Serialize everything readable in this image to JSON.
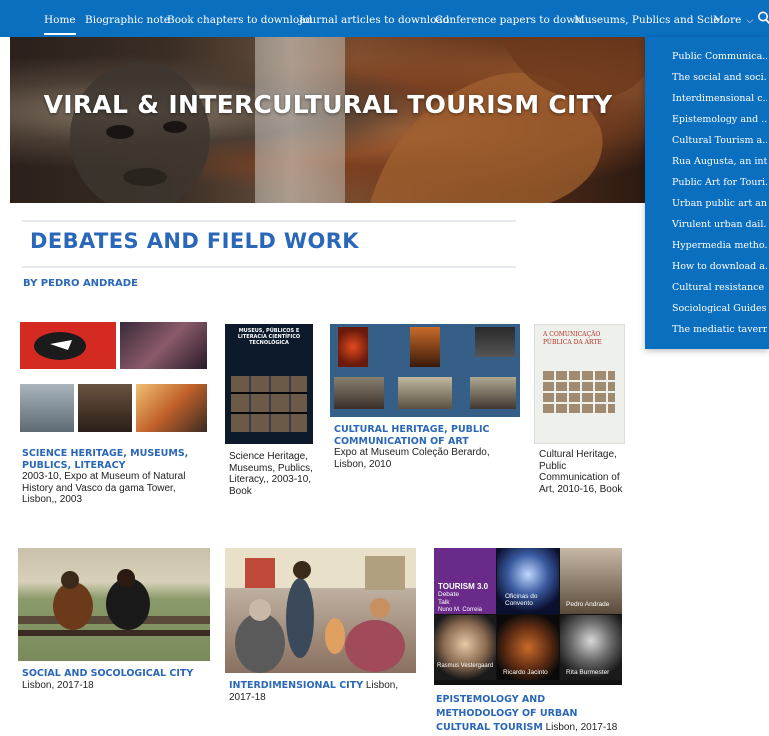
{
  "nav": {
    "items": [
      "Home",
      "Biographic note",
      "Book chapters to download",
      "Journal articles to download",
      "Conference papers to down...",
      "Museums, Publics and Scie..."
    ],
    "more_label": "More"
  },
  "dropdown": {
    "items": [
      "Public Communica...",
      "The social and soci...",
      "Interdimensional c...",
      "Epistemology and ...",
      "Cultural Tourism a...",
      "Rua Augusta, an int...",
      "Public Art for Touri...",
      "Urban public art an...",
      "Virulent urban dail...",
      "Hypermedia metho...",
      "How to download a...",
      "Cultural resistance ...",
      "Sociological Guides...",
      "The mediatic tavern"
    ]
  },
  "hero": {
    "title": "VIRAL & INTERCULTURAL TOURISM CITY"
  },
  "page": {
    "title": "DEBATES AND FIELD WORK",
    "byline": "BY PEDRO ANDRADE"
  },
  "cards": [
    {
      "link": "SCIENCE HERITAGE, MUSEUMS, PUBLICS, LITERACY",
      "desc": "2003-10, Expo at Museum of Natural History and Vasco da gama Tower, Lisbon,, 2003"
    },
    {
      "link": "",
      "desc": "Science Heritage, Museums, Publics, Literacy,, 2003-10, Book"
    },
    {
      "link": "CULTURAL HERITAGE, PUBLIC COMMUNICATION OF ART",
      "desc": "Expo at Museum Coleção Berardo, Lisbon, 2010"
    },
    {
      "link": "",
      "desc": "Cultural Heritage, Public Communication of Art, 2010-16, Book"
    },
    {
      "link": "SOCIAL AND SOCOLOGICAL CITY",
      "desc": "Lisbon,  2017-18"
    },
    {
      "link": "INTERDIMENSIONAL CITY",
      "desc": " Lisbon, 2017-18"
    },
    {
      "link": "EPISTEMOLOGY AND METHODOLOGY OF URBAN CULTURAL TOURISM",
      "desc": " Lisbon, 2017-18"
    }
  ],
  "book_cover": {
    "title": "MUSEUS, PÚBLICOS E LITERACIA CIENTÍFICO TECNOLÓGICA",
    "art_title": "A COMUNICAÇÃO PÚBLICA DA ARTE"
  },
  "poster": {
    "header": "TOURISM 3.0",
    "sub1": "Debate",
    "sub2": "Talk",
    "name1": "Nuno M. Correia",
    "name2": "Oficinas do Convento",
    "name3": "Pedro Andrade",
    "name4": "Rasmus Vestergaard",
    "name5": "Ricardo Jacinto",
    "name6": "Rita Burmester"
  },
  "colors": {
    "nav": "#0b6fc0",
    "accent": "#2a67b8"
  }
}
